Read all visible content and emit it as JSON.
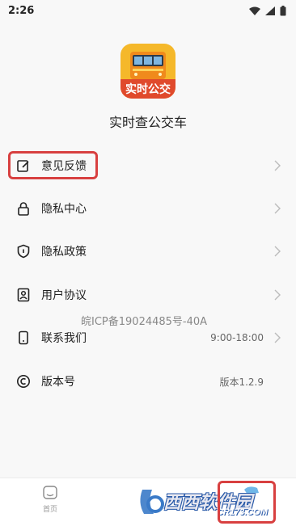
{
  "status_bar": {
    "time": "2:26",
    "icons": [
      "wifi-icon",
      "signal-icon",
      "battery-icon"
    ]
  },
  "app": {
    "icon_text": "实时公交",
    "name": "实时查公交车"
  },
  "menu": [
    {
      "id": "feedback",
      "label": "意见反馈",
      "value": "",
      "icon": "edit-icon"
    },
    {
      "id": "privacy-center",
      "label": "隐私中心",
      "value": "",
      "icon": "lock-icon"
    },
    {
      "id": "privacy-policy",
      "label": "隐私政策",
      "value": "",
      "icon": "shield-icon"
    },
    {
      "id": "user-agreement",
      "label": "用户协议",
      "value": "",
      "icon": "user-doc-icon"
    },
    {
      "id": "contact",
      "label": "联系我们",
      "value": "9:00-18:00",
      "icon": "phone-icon"
    },
    {
      "id": "version",
      "label": "版本号",
      "value": "版本1.2.9",
      "icon": "copyright-icon"
    }
  ],
  "icp_text": "皖ICP备19024485号-40A",
  "tab_bar": {
    "home_label": "首页"
  },
  "watermark": {
    "brand": "西西软件园",
    "url": "CR173.COM"
  },
  "colors": {
    "highlight": "#d84040",
    "app_icon_bg": "#f5b82a",
    "app_icon_band": "#e04a2c"
  }
}
